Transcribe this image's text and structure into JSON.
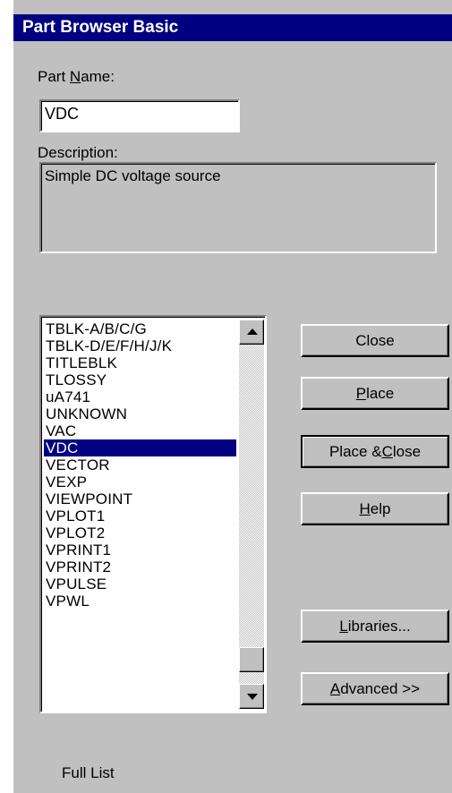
{
  "window": {
    "title": "Part Browser Basic"
  },
  "part_name": {
    "label_pre": "Part ",
    "label_underline": "N",
    "label_post": "ame:",
    "value": "VDC"
  },
  "description": {
    "label": "Description:",
    "value": "Simple DC voltage source"
  },
  "parts_list": {
    "items": [
      "TBLK-A/B/C/G",
      "TBLK-D/E/F/H/J/K",
      "TITLEBLK",
      "TLOSSY",
      "uA741",
      "UNKNOWN",
      "VAC",
      "VDC",
      "VECTOR",
      "VEXP",
      "VIEWPOINT",
      "VPLOT1",
      "VPLOT2",
      "VPRINT1",
      "VPRINT2",
      "VPULSE",
      "VPWL"
    ],
    "selected": "VDC"
  },
  "buttons": {
    "close": {
      "pre": "Close",
      "u": "",
      "post": ""
    },
    "place": {
      "pre": "",
      "u": "P",
      "post": "lace"
    },
    "place_close": {
      "pre": "Place & ",
      "u": "C",
      "post": "lose"
    },
    "help": {
      "pre": "",
      "u": "H",
      "post": "elp"
    },
    "libraries": {
      "pre": "",
      "u": "L",
      "post": "ibraries..."
    },
    "advanced": {
      "pre": "",
      "u": "A",
      "post": "dvanced >>"
    }
  },
  "footer": {
    "full_list_label": "Full List"
  }
}
